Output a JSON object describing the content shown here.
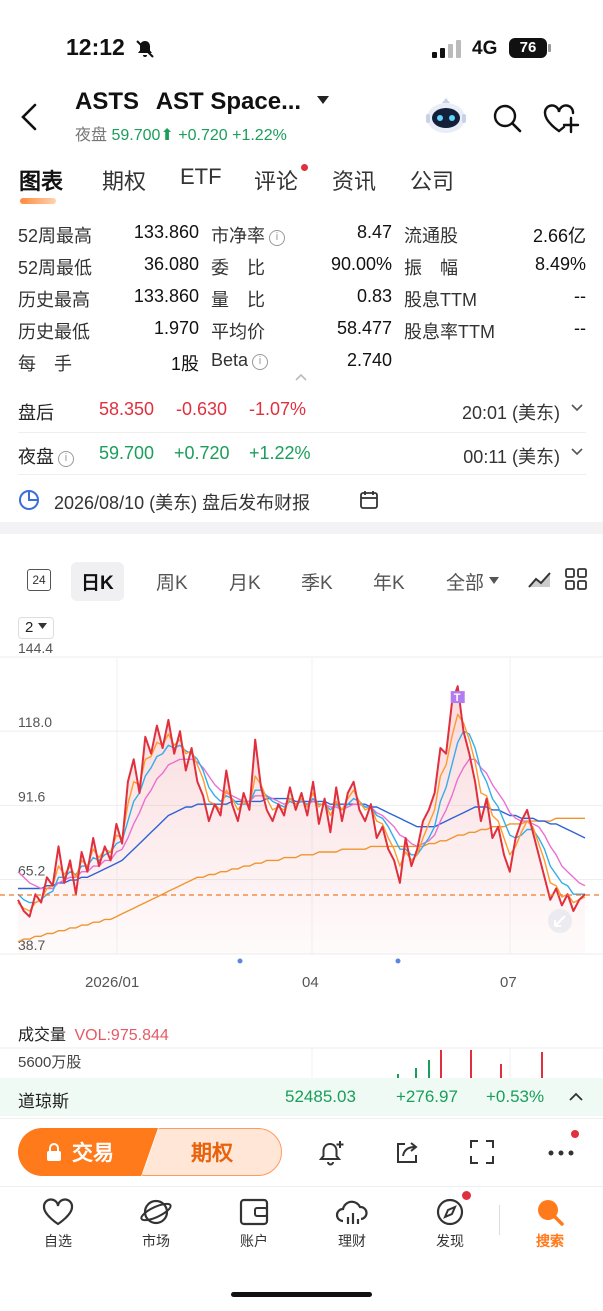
{
  "status_bar": {
    "time": "12:12",
    "network": "4G",
    "battery": "76"
  },
  "header": {
    "ticker": "ASTS",
    "name": "AST Space...",
    "session_label": "夜盘",
    "price": "59.700",
    "change": "+0.720",
    "change_pct": "+1.22%"
  },
  "tabs": [
    {
      "label": "图表"
    },
    {
      "label": "期权"
    },
    {
      "label": "ETF"
    },
    {
      "label": "评论"
    },
    {
      "label": "资讯"
    },
    {
      "label": "公司"
    }
  ],
  "stats": {
    "col1": [
      {
        "label": "52周最高",
        "value": "133.860"
      },
      {
        "label": "52周最低",
        "value": "36.080"
      },
      {
        "label": "历史最高",
        "value": "133.860"
      },
      {
        "label": "历史最低",
        "value": "1.970"
      },
      {
        "label": "每　手",
        "value": "1股"
      }
    ],
    "col2": [
      {
        "label": "市净率",
        "value": "8.47"
      },
      {
        "label": "委　比",
        "value": "90.00%"
      },
      {
        "label": "量　比",
        "value": "0.83"
      },
      {
        "label": "平均价",
        "value": "58.477"
      },
      {
        "label": "Beta",
        "value": "2.740"
      }
    ],
    "col3": [
      {
        "label": "流通股",
        "value": "2.66亿"
      },
      {
        "label": "振　幅",
        "value": "8.49%"
      },
      {
        "label": "股息TTM",
        "value": "--"
      },
      {
        "label": "股息率TTM",
        "value": "--"
      }
    ]
  },
  "after_hours": {
    "label": "盘后",
    "price": "58.350",
    "change": "-0.630",
    "change_pct": "-1.07%",
    "time": "20:01 (美东)"
  },
  "overnight": {
    "label": "夜盘",
    "price": "59.700",
    "change": "+0.720",
    "change_pct": "+1.22%",
    "time": "00:11 (美东)"
  },
  "earnings": {
    "text": "2026/08/10 (美东) 盘后发布财报"
  },
  "chart_periods": [
    {
      "label": "日K"
    },
    {
      "label": "周K"
    },
    {
      "label": "月K"
    },
    {
      "label": "季K"
    },
    {
      "label": "年K"
    },
    {
      "label": "全部"
    }
  ],
  "calendar_day": "24",
  "line_width_select": "2",
  "chart_data": {
    "type": "line",
    "y_ticks": [
      "144.4",
      "118.0",
      "91.6",
      "65.2",
      "38.7"
    ],
    "x_ticks": [
      "2026/01",
      "04",
      "07"
    ],
    "ylim": [
      38.7,
      144.4
    ],
    "current_price_line": 59.7,
    "grid": true,
    "series": [
      {
        "color": "#e0303e",
        "values": [
          58,
          54,
          52,
          60,
          57,
          66,
          63,
          77,
          64,
          72,
          60,
          75,
          68,
          80,
          70,
          77,
          72,
          85,
          78,
          100,
          108,
          96,
          116,
          110,
          120,
          112,
          122,
          110,
          118,
          104,
          112,
          100,
          95,
          86,
          92,
          88,
          104,
          92,
          86,
          96,
          90,
          115,
          98,
          90,
          86,
          92,
          88,
          98,
          90,
          96,
          88,
          100,
          85,
          94,
          82,
          98,
          86,
          96,
          100,
          90,
          86,
          92,
          80,
          84,
          76,
          72,
          64,
          80,
          70,
          76,
          86,
          90,
          96,
          112,
          110,
          128,
          134,
          118,
          110,
          100,
          86,
          94,
          80,
          84,
          74,
          68,
          80,
          86,
          90,
          82,
          74,
          66,
          58,
          62,
          56,
          60,
          54,
          58,
          60
        ]
      },
      {
        "color": "#ff9a2e",
        "values": [
          57,
          55,
          54,
          57,
          58,
          62,
          63,
          70,
          67,
          70,
          66,
          72,
          70,
          76,
          73,
          76,
          75,
          81,
          80,
          92,
          100,
          99,
          108,
          109,
          114,
          113,
          117,
          113,
          115,
          110,
          111,
          106,
          101,
          93,
          92,
          90,
          97,
          94,
          90,
          93,
          91,
          102,
          99,
          94,
          90,
          91,
          90,
          94,
          92,
          94,
          91,
          96,
          91,
          93,
          88,
          93,
          90,
          94,
          97,
          93,
          90,
          91,
          86,
          85,
          80,
          76,
          70,
          75,
          72,
          74,
          80,
          85,
          90,
          102,
          106,
          116,
          124,
          121,
          115,
          107,
          96,
          95,
          88,
          86,
          80,
          74,
          77,
          82,
          86,
          84,
          78,
          72,
          64,
          63,
          59,
          60,
          57,
          58,
          59
        ]
      },
      {
        "color": "#33aee8",
        "values": [
          60,
          58,
          57,
          57,
          58,
          60,
          61,
          66,
          66,
          68,
          67,
          70,
          70,
          73,
          72,
          74,
          75,
          78,
          79,
          86,
          93,
          96,
          102,
          105,
          109,
          110,
          113,
          112,
          113,
          111,
          110,
          108,
          104,
          98,
          95,
          93,
          95,
          94,
          92,
          92,
          92,
          97,
          97,
          95,
          93,
          92,
          91,
          93,
          92,
          93,
          92,
          94,
          92,
          92,
          90,
          92,
          90,
          92,
          94,
          93,
          91,
          91,
          88,
          87,
          84,
          80,
          76,
          76,
          74,
          74,
          77,
          80,
          84,
          93,
          98,
          106,
          114,
          118,
          117,
          112,
          104,
          100,
          94,
          91,
          86,
          81,
          80,
          81,
          83,
          83,
          80,
          76,
          70,
          67,
          64,
          63,
          60,
          60,
          60
        ]
      },
      {
        "color": "#e970d2",
        "values": [
          68,
          66,
          64,
          63,
          62,
          62,
          62,
          64,
          65,
          66,
          66,
          68,
          68,
          70,
          70,
          72,
          72,
          75,
          76,
          80,
          85,
          89,
          94,
          97,
          101,
          103,
          106,
          107,
          108,
          108,
          108,
          107,
          105,
          102,
          99,
          97,
          96,
          95,
          94,
          93,
          93,
          95,
          95,
          95,
          94,
          93,
          92,
          93,
          92,
          93,
          92,
          93,
          92,
          92,
          91,
          91,
          90,
          91,
          92,
          92,
          91,
          91,
          89,
          88,
          86,
          84,
          81,
          80,
          78,
          77,
          78,
          79,
          81,
          86,
          90,
          95,
          101,
          105,
          108,
          108,
          105,
          103,
          99,
          96,
          93,
          89,
          87,
          86,
          86,
          85,
          84,
          81,
          77,
          74,
          70,
          68,
          66,
          64,
          63
        ]
      },
      {
        "color": "#2d62d6",
        "values": [
          62,
          62,
          62,
          62,
          62,
          63,
          63,
          64,
          64,
          65,
          65,
          66,
          66,
          67,
          68,
          69,
          70,
          71,
          72,
          74,
          76,
          78,
          80,
          82,
          84,
          86,
          88,
          89,
          90,
          91,
          91,
          92,
          92,
          92,
          92,
          92,
          92,
          93,
          93,
          93,
          93,
          93,
          93,
          94,
          94,
          94,
          94,
          94,
          93,
          93,
          93,
          93,
          93,
          93,
          92,
          92,
          92,
          92,
          92,
          92,
          92,
          91,
          91,
          90,
          89,
          88,
          87,
          86,
          85,
          84,
          84,
          84,
          84,
          85,
          86,
          87,
          88,
          89,
          90,
          91,
          91,
          91,
          90,
          90,
          89,
          88,
          88,
          87,
          87,
          87,
          86,
          86,
          85,
          85,
          84,
          83,
          82,
          81,
          80
        ]
      },
      {
        "color": "#f0952e",
        "values": [
          43,
          44,
          44,
          45,
          45,
          46,
          46,
          47,
          47,
          48,
          48,
          49,
          49,
          50,
          50,
          51,
          51,
          52,
          53,
          54,
          55,
          56,
          57,
          58,
          59,
          60,
          61,
          62,
          63,
          64,
          65,
          66,
          66,
          67,
          67,
          68,
          68,
          69,
          69,
          70,
          70,
          71,
          71,
          72,
          72,
          72,
          73,
          73,
          73,
          74,
          74,
          74,
          75,
          75,
          75,
          75,
          76,
          76,
          76,
          76,
          76,
          77,
          77,
          77,
          77,
          77,
          77,
          77,
          77,
          77,
          77,
          78,
          78,
          79,
          79,
          80,
          81,
          81,
          82,
          82,
          83,
          83,
          84,
          84,
          84,
          85,
          85,
          85,
          86,
          86,
          86,
          86,
          86,
          87,
          87,
          87,
          87,
          87,
          87
        ]
      }
    ]
  },
  "volume": {
    "title": "成交量",
    "vol_label": "VOL:975.844",
    "axis_label": "5600万股"
  },
  "index_bar": {
    "name": "道琼斯",
    "value": "52485.03",
    "change": "+276.97",
    "change_pct": "+0.53%"
  },
  "toolbar": {
    "trade_label": "交易",
    "options_label": "期权"
  },
  "bottom_nav": [
    {
      "label": "自选"
    },
    {
      "label": "市场"
    },
    {
      "label": "账户"
    },
    {
      "label": "理财"
    },
    {
      "label": "发现"
    },
    {
      "label": "搜索"
    }
  ],
  "colors": {
    "accent": "#ff7a1a",
    "up": "#1a9e5a",
    "down": "#e0303e"
  }
}
